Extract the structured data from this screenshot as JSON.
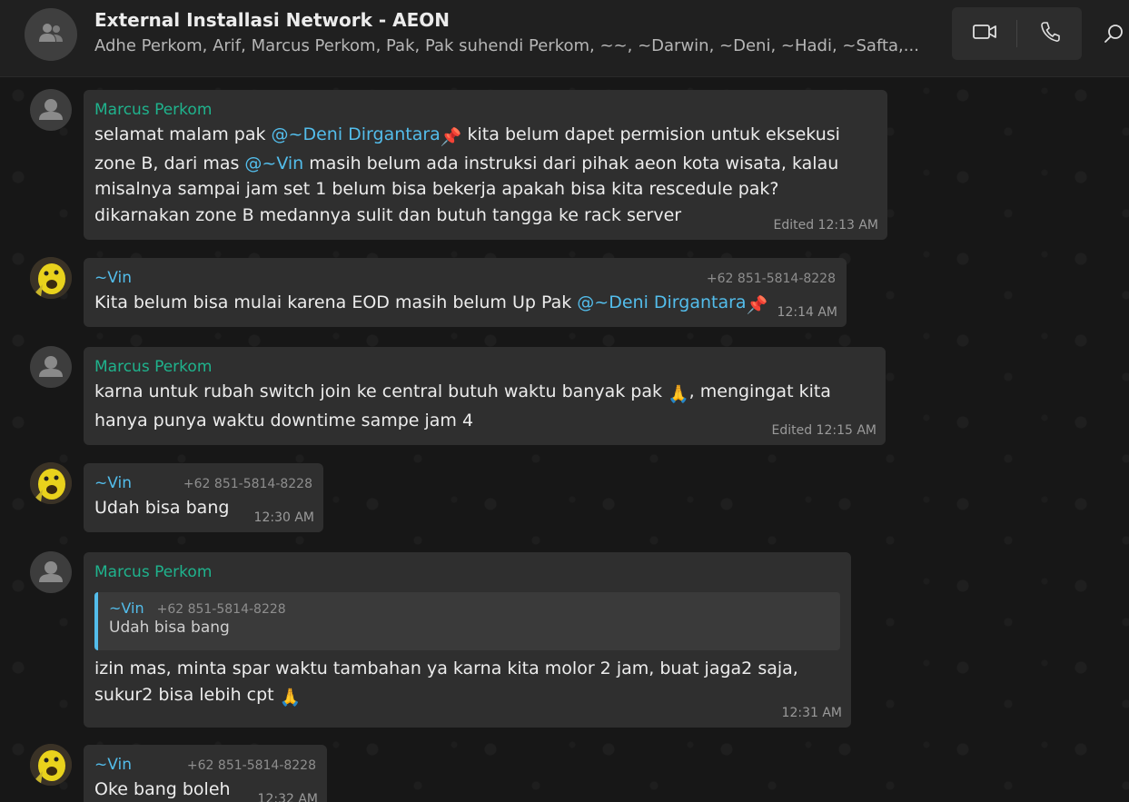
{
  "header": {
    "title": "External Installasi Network - AEON",
    "members": "Adhe Perkom, Arif, Marcus Perkom, Pak, Pak suhendi Perkom, ~~, ~Darwin, ~Deni, ~Hadi, ~Safta,..."
  },
  "icons": {
    "group_avatar": "group-icon",
    "video_call": "video-camera-icon",
    "voice_call": "phone-icon",
    "search": "search-icon",
    "pin_emoji": "pushpin",
    "pray_emoji": "folded-hands"
  },
  "colors": {
    "marcus_name": "#1fb38d",
    "vin_name": "#53bdeb",
    "mention": "#53bdeb",
    "bubble": "#2f2f2f"
  },
  "messages": [
    {
      "sender": "Marcus Perkom",
      "segments": [
        {
          "t": "selamat malam pak "
        },
        {
          "t": "@~Deni Dirgantara",
          "mention": true
        },
        {
          "t": "📌",
          "emoji": true
        },
        {
          "t": " kita belum dapet permision untuk eksekusi zone B, dari mas "
        },
        {
          "t": "@~Vin",
          "mention": true
        },
        {
          "t": " masih belum ada instruksi dari pihak aeon kota wisata, kalau misalnya sampai jam set 1 belum bisa bekerja apakah bisa kita rescedule pak? dikarnakan zone B medannya sulit dan butuh tangga ke rack server"
        }
      ],
      "time": "Edited 12:13 AM"
    },
    {
      "sender": "~Vin",
      "phone": "+62 851-5814-8228",
      "segments": [
        {
          "t": "Kita belum bisa mulai karena EOD masih belum Up Pak "
        },
        {
          "t": "@~Deni Dirgantara",
          "mention": true
        },
        {
          "t": "📌",
          "emoji": true
        }
      ],
      "time": "12:14 AM"
    },
    {
      "sender": "Marcus Perkom",
      "segments": [
        {
          "t": "karna untuk rubah switch join ke central butuh waktu banyak pak "
        },
        {
          "t": "🙏",
          "emoji": true
        },
        {
          "t": ", mengingat kita hanya punya waktu downtime sampe jam 4"
        }
      ],
      "time": "Edited 12:15 AM"
    },
    {
      "sender": "~Vin",
      "phone": "+62 851-5814-8228",
      "segments": [
        {
          "t": "Udah bisa bang"
        }
      ],
      "time": "12:30 AM"
    },
    {
      "sender": "Marcus Perkom",
      "quote": {
        "name": "~Vin",
        "phone": "+62 851-5814-8228",
        "text": "Udah bisa bang"
      },
      "segments": [
        {
          "t": "izin mas, minta spar waktu tambahan ya karna kita molor 2 jam, buat jaga2 saja, sukur2 bisa lebih cpt "
        },
        {
          "t": "🙏",
          "emoji": true
        }
      ],
      "time": "12:31 AM"
    },
    {
      "sender": "~Vin",
      "phone": "+62 851-5814-8228",
      "segments": [
        {
          "t": "Oke bang boleh"
        }
      ],
      "time": "12:32 AM"
    }
  ]
}
